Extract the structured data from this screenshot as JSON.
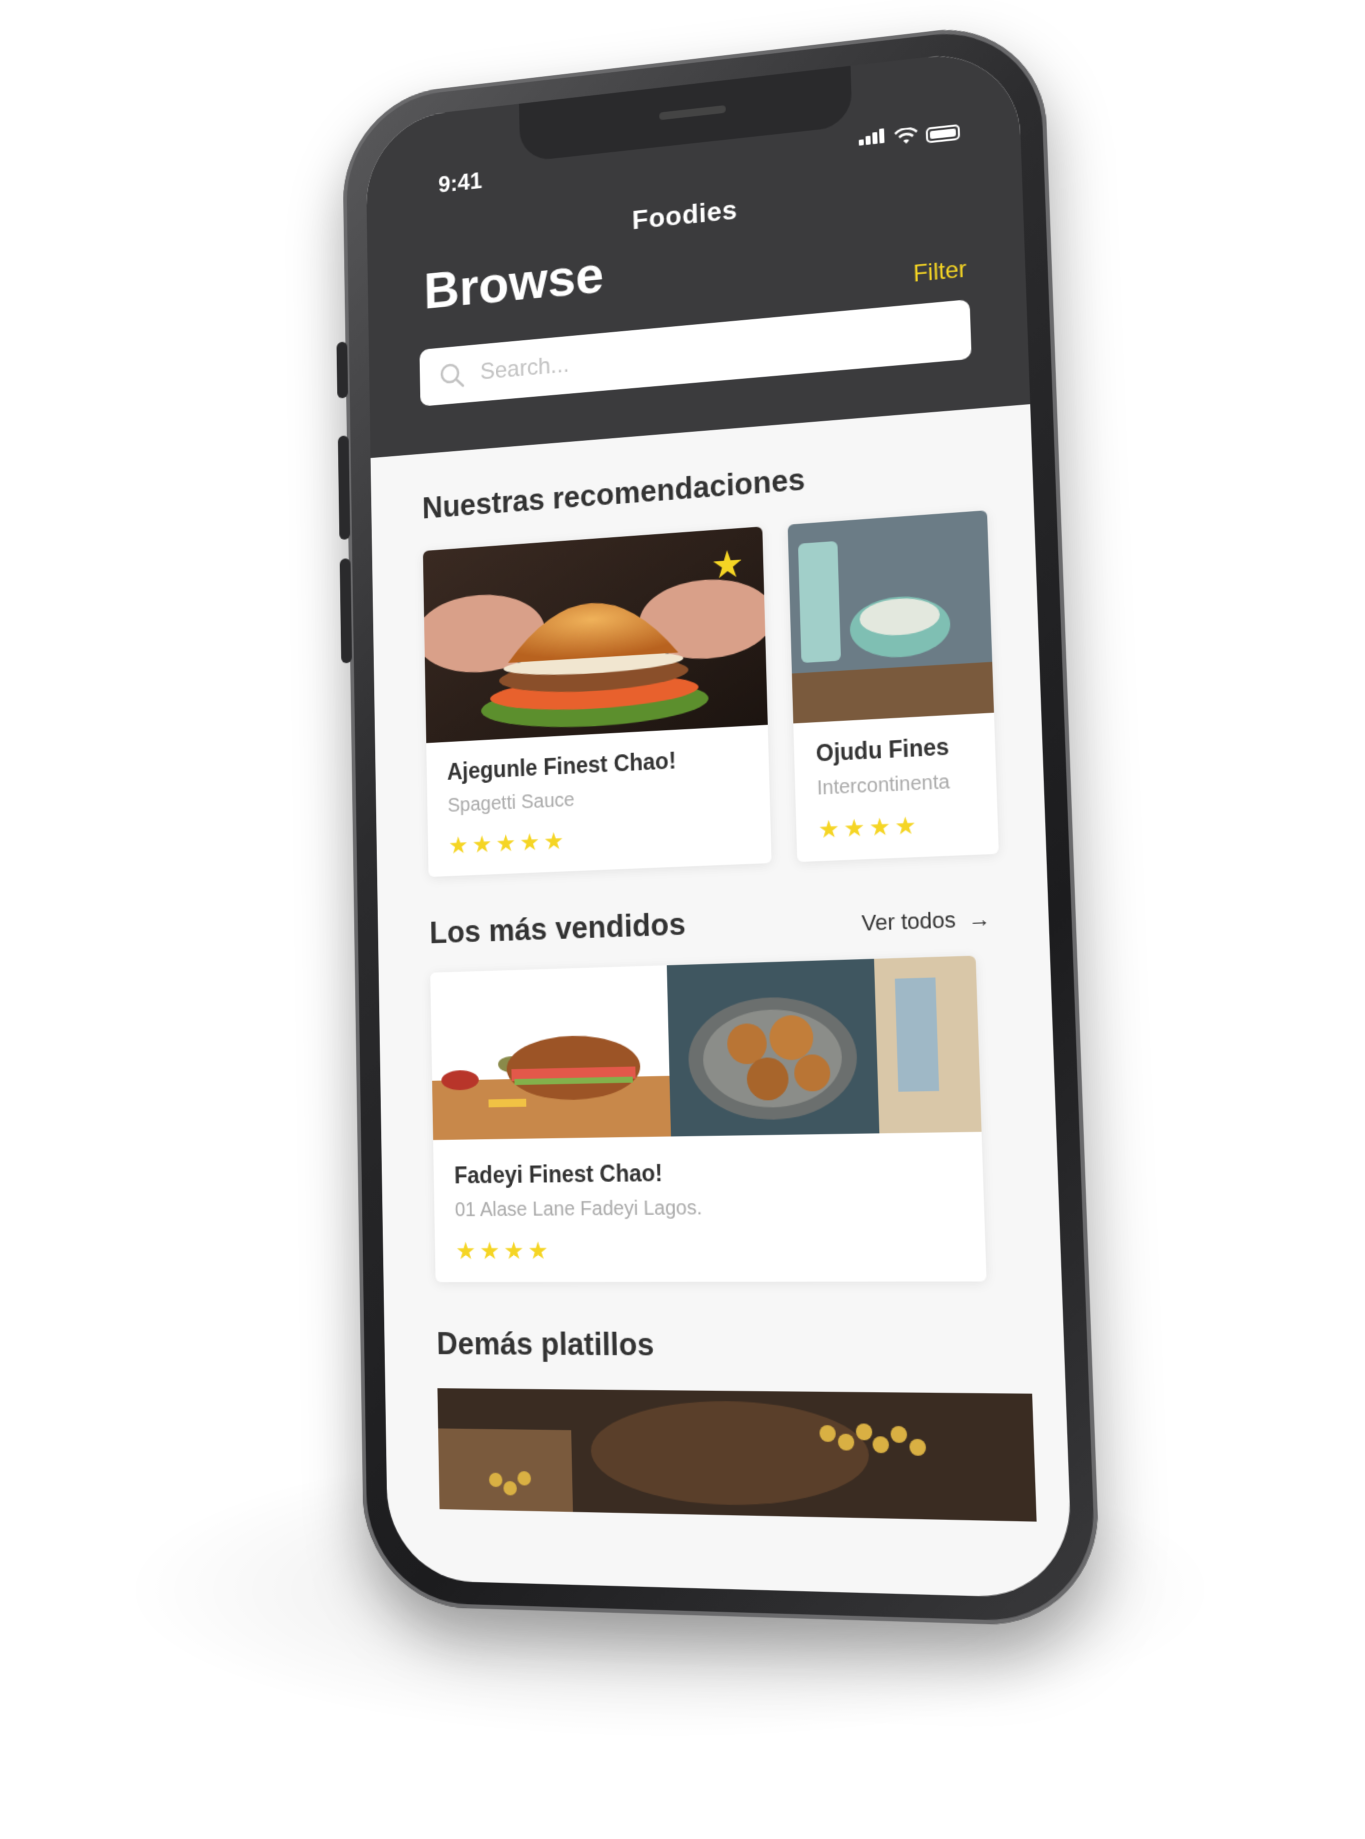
{
  "status_bar": {
    "time": "9:41"
  },
  "header": {
    "app_title": "Foodies",
    "page_title": "Browse",
    "filter_label": "Filter",
    "search_placeholder": "Search..."
  },
  "recommendations": {
    "title": "Nuestras recomendaciones",
    "cards": [
      {
        "name": "Ajegunle Finest Chao!",
        "subtitle": "Spagetti Sauce",
        "rating": 5,
        "favorite": true
      },
      {
        "name": "Ojudu Fines",
        "subtitle": "Intercontinenta",
        "rating": 4,
        "favorite": false
      }
    ]
  },
  "best_sellers": {
    "title": "Los más vendidos",
    "see_all": "Ver todos",
    "card": {
      "name": "Fadeyi Finest Chao!",
      "address": "01 Alase Lane Fadeyi Lagos.",
      "rating": 4
    }
  },
  "other_dishes": {
    "title": "Demás platillos"
  },
  "colors": {
    "header_bg": "#3b3b3d",
    "accent": "#f5d524",
    "text_dark": "#333333",
    "text_muted": "#aaaaaa"
  }
}
